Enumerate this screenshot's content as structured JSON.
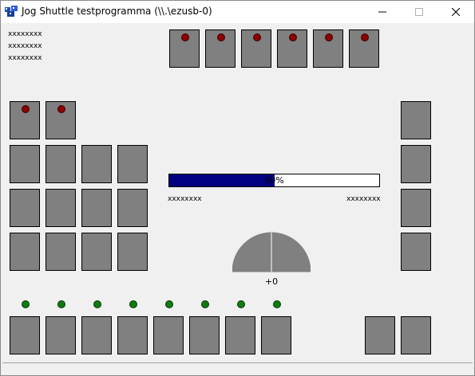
{
  "window": {
    "title": "Jog Shuttle testprogramma (\\\\.\\ezusb-0)",
    "controls": {
      "minimize": "minimize-icon",
      "maximize": "maximize-icon",
      "close": "close-icon"
    }
  },
  "top_left_labels": [
    "xxxxxxxx",
    "xxxxxxxx",
    "xxxxxxxx"
  ],
  "progress": {
    "percent": 50,
    "text": "50%",
    "fill_color": "#000080"
  },
  "progress_labels": {
    "left": "xxxxxxxx",
    "right": "xxxxxxxx"
  },
  "gauge": {
    "value_text": "+0",
    "color": "#808080"
  },
  "key_color": "#808080",
  "led_colors": {
    "red": "#8b0000",
    "green": "#0f7a0f"
  }
}
